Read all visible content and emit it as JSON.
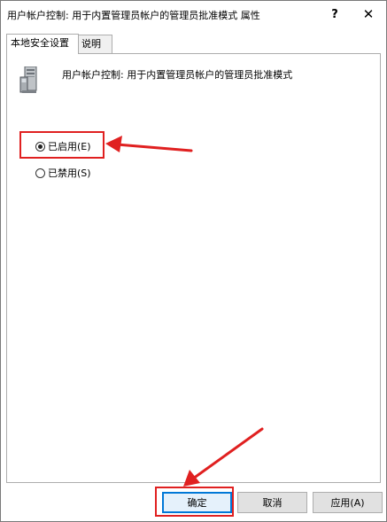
{
  "window": {
    "title": "用户帐户控制: 用于内置管理员帐户的管理员批准模式 属性",
    "help_label": "?",
    "close_label": "✕"
  },
  "tabs": [
    {
      "label": "本地安全设置",
      "active": true
    },
    {
      "label": "说明",
      "active": false
    }
  ],
  "panel": {
    "icon": "server-computer-icon",
    "policy_title": "用户帐户控制: 用于内置管理员帐户的管理员批准模式",
    "options": [
      {
        "label": "已启用(E)",
        "checked": true
      },
      {
        "label": "已禁用(S)",
        "checked": false
      }
    ]
  },
  "buttons": {
    "ok": "确定",
    "cancel": "取消",
    "apply": "应用(A)"
  },
  "annotation": {
    "color": "#e02020"
  }
}
